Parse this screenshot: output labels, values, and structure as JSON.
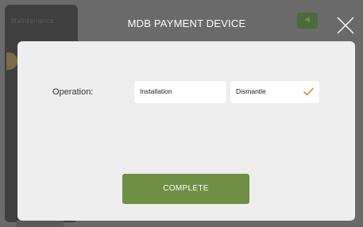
{
  "header": {
    "title": "MDB PAYMENT DEVICE"
  },
  "background_app": {
    "sidebar_label": "Maintenance"
  },
  "form": {
    "operation_label": "Operation:",
    "options": [
      {
        "label": "Installation",
        "selected": false
      },
      {
        "label": "Dismantle",
        "selected": true
      }
    ]
  },
  "actions": {
    "complete_label": "COMPLETE"
  },
  "colors": {
    "accent_green": "#6f8f45",
    "check_orange": "#e08a2c",
    "overlay": "#6a6a6a",
    "dialog_bg": "#eeeeee"
  },
  "icons": {
    "close": "close-icon",
    "selected": "check-icon"
  }
}
